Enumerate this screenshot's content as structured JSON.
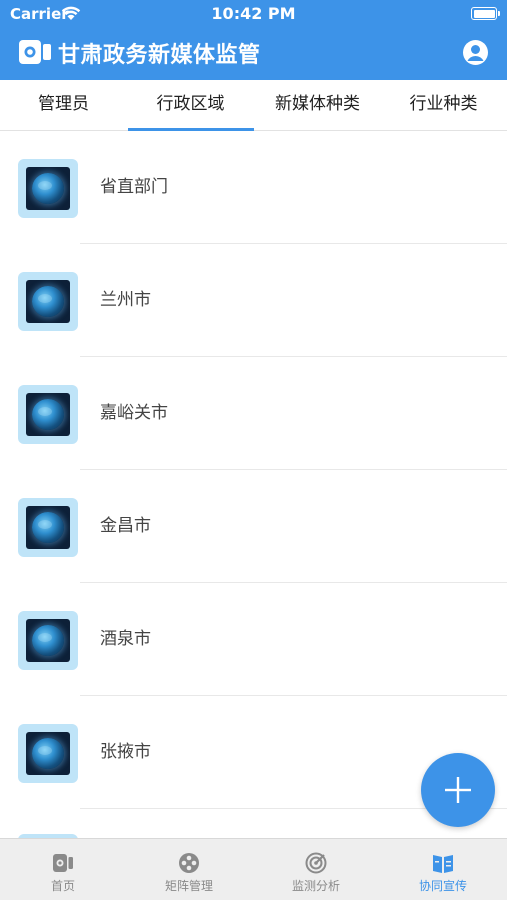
{
  "status_bar": {
    "carrier": "Carrier",
    "time": "10:42 PM"
  },
  "header": {
    "title": "甘肃政务新媒体监管",
    "logo_icon": "video-camera-icon",
    "profile_icon": "user-icon"
  },
  "tabs": [
    {
      "label": "管理员",
      "active": false
    },
    {
      "label": "行政区域",
      "active": true
    },
    {
      "label": "新媒体种类",
      "active": false
    },
    {
      "label": "行业种类",
      "active": false
    }
  ],
  "list_items": [
    {
      "label": "省直部门"
    },
    {
      "label": "兰州市"
    },
    {
      "label": "嘉峪关市"
    },
    {
      "label": "金昌市"
    },
    {
      "label": "酒泉市"
    },
    {
      "label": "张掖市"
    },
    {
      "label": ""
    }
  ],
  "fab": {
    "icon": "plus-icon"
  },
  "bottom_tabs": [
    {
      "label": "首页",
      "icon": "home-camera-icon",
      "active": false
    },
    {
      "label": "矩阵管理",
      "icon": "matrix-icon",
      "active": false
    },
    {
      "label": "监测分析",
      "icon": "radar-icon",
      "active": false
    },
    {
      "label": "协同宣传",
      "icon": "book-icon",
      "active": true
    }
  ],
  "colors": {
    "primary": "#3d93e8",
    "tab_inactive": "#8a8a8a",
    "thumb_bg": "#bfe4f8"
  }
}
